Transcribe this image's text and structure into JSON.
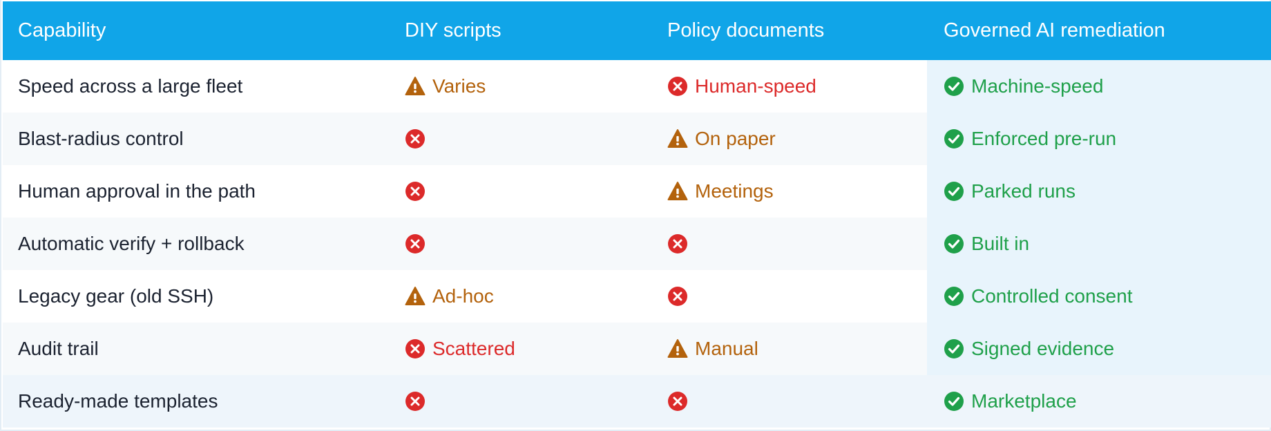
{
  "colors": {
    "header_bg": "#10a5e8",
    "good": "#1fa04a",
    "bad": "#dc2a2a",
    "warn": "#b3620c"
  },
  "columns": [
    "Capability",
    "DIY scripts",
    "Policy documents",
    "Governed AI remediation"
  ],
  "rows": [
    {
      "capability": "Speed across a large fleet",
      "diy": {
        "status": "warn",
        "icon": "warning-icon",
        "text": "Varies"
      },
      "policy": {
        "status": "bad",
        "icon": "x-circle-icon",
        "text": "Human-speed"
      },
      "governed": {
        "status": "good",
        "icon": "check-circle-icon",
        "text": "Machine-speed"
      }
    },
    {
      "capability": "Blast-radius control",
      "diy": {
        "status": "bad",
        "icon": "x-circle-icon",
        "text": ""
      },
      "policy": {
        "status": "warn",
        "icon": "warning-icon",
        "text": "On paper"
      },
      "governed": {
        "status": "good",
        "icon": "check-circle-icon",
        "text": "Enforced pre-run"
      }
    },
    {
      "capability": "Human approval in the path",
      "diy": {
        "status": "bad",
        "icon": "x-circle-icon",
        "text": ""
      },
      "policy": {
        "status": "warn",
        "icon": "warning-icon",
        "text": "Meetings"
      },
      "governed": {
        "status": "good",
        "icon": "check-circle-icon",
        "text": "Parked runs"
      }
    },
    {
      "capability": "Automatic verify + rollback",
      "diy": {
        "status": "bad",
        "icon": "x-circle-icon",
        "text": ""
      },
      "policy": {
        "status": "bad",
        "icon": "x-circle-icon",
        "text": ""
      },
      "governed": {
        "status": "good",
        "icon": "check-circle-icon",
        "text": "Built in"
      }
    },
    {
      "capability": "Legacy gear (old SSH)",
      "diy": {
        "status": "warn",
        "icon": "warning-icon",
        "text": "Ad-hoc"
      },
      "policy": {
        "status": "bad",
        "icon": "x-circle-icon",
        "text": ""
      },
      "governed": {
        "status": "good",
        "icon": "check-circle-icon",
        "text": "Controlled consent"
      }
    },
    {
      "capability": "Audit trail",
      "diy": {
        "status": "bad",
        "icon": "x-circle-icon",
        "text": "Scattered"
      },
      "policy": {
        "status": "warn",
        "icon": "warning-icon",
        "text": "Manual"
      },
      "governed": {
        "status": "good",
        "icon": "check-circle-icon",
        "text": "Signed evidence"
      }
    },
    {
      "capability": "Ready-made templates",
      "diy": {
        "status": "bad",
        "icon": "x-circle-icon",
        "text": ""
      },
      "policy": {
        "status": "bad",
        "icon": "x-circle-icon",
        "text": ""
      },
      "governed": {
        "status": "good",
        "icon": "check-circle-icon",
        "text": "Marketplace"
      }
    }
  ]
}
